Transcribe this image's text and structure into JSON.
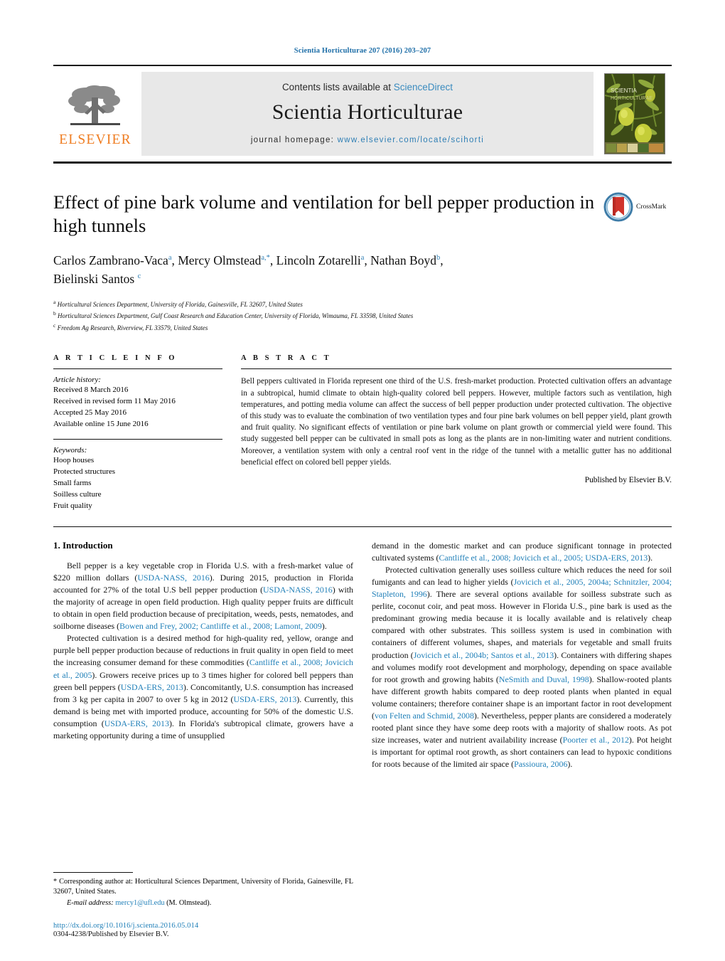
{
  "running_head": "Scientia Horticulturae 207 (2016) 203–207",
  "masthead": {
    "publisher_name": "ELSEVIER",
    "contents_prefix": "Contents lists available at ",
    "contents_link": "ScienceDirect",
    "journal_name": "Scientia Horticulturae",
    "homepage_prefix": "journal homepage: ",
    "homepage_url": "www.elsevier.com/locate/scihorti",
    "cover_title_line1": "SCIENTIA",
    "cover_title_line2": "HORTICULTURAE"
  },
  "article": {
    "title": "Effect of pine bark volume and ventilation for bell pepper production in high tunnels",
    "authors_line1": "Carlos Zambrano-Vaca",
    "authors_sup1": "a",
    "authors_line1b": ", Mercy Olmstead",
    "authors_sup2": "a,*",
    "authors_line1c": ", Lincoln Zotarelli",
    "authors_sup3": "a",
    "authors_line1d": ", Nathan Boyd",
    "authors_sup4": "b",
    "authors_line2": "Bielinski Santos",
    "authors_sup5": "c",
    "affiliations": [
      {
        "marker": "a",
        "text": "Horticultural Sciences Department, University of Florida, Gainesville, FL 32607, United States"
      },
      {
        "marker": "b",
        "text": "Horticultural Sciences Department, Gulf Coast Research and Education Center, University of Florida, Wimauma, FL 33598, United States"
      },
      {
        "marker": "c",
        "text": "Freedom Ag Research, Riverview, FL 33579, United States"
      }
    ],
    "crossmark_label": "CrossMark"
  },
  "article_info": {
    "heading": "A R T I C L E   I N F O",
    "history_label": "Article history:",
    "history": [
      "Received 8 March 2016",
      "Received in revised form 11 May 2016",
      "Accepted 25 May 2016",
      "Available online 15 June 2016"
    ],
    "keywords_label": "Keywords:",
    "keywords": [
      "Hoop houses",
      "Protected structures",
      "Small farms",
      "Soilless culture",
      "Fruit quality"
    ]
  },
  "abstract": {
    "heading": "A B S T R A C T",
    "text": "Bell peppers cultivated in Florida represent one third of the U.S. fresh-market production. Protected cultivation offers an advantage in a subtropical, humid climate to obtain high-quality colored bell peppers. However, multiple factors such as ventilation, high temperatures, and potting media volume can affect the success of bell pepper production under protected cultivation. The objective of this study was to evaluate the combination of two ventilation types and four pine bark volumes on bell pepper yield, plant growth and fruit quality. No significant effects of ventilation or pine bark volume on plant growth or commercial yield were found. This study suggested bell pepper can be cultivated in small pots as long as the plants are in non-limiting water and nutrient conditions. Moreover, a ventilation system with only a central roof vent in the ridge of the tunnel with a metallic gutter has no additional beneficial effect on colored bell pepper yields.",
    "published_by": "Published by Elsevier B.V."
  },
  "body": {
    "section_title": "1. Introduction",
    "left_p1_a": "Bell pepper is a key vegetable crop in Florida U.S. with a fresh-market value of $220 million dollars (",
    "left_p1_ref1": "USDA-NASS, 2016",
    "left_p1_b": "). During 2015, production in Florida accounted for 27% of the total U.S bell pepper production (",
    "left_p1_ref2": "USDA-NASS, 2016",
    "left_p1_c": ") with the majority of acreage in open field production. High quality pepper fruits are difficult to obtain in open field production because of precipitation, weeds, pests, nematodes, and soilborne diseases (",
    "left_p1_ref3": "Bowen and Frey, 2002; Cantliffe et al., 2008; Lamont, 2009",
    "left_p1_d": ").",
    "left_p2_a": "Protected cultivation is a desired method for high-quality red, yellow, orange and purple bell pepper production because of reductions in fruit quality in open field to meet the increasing consumer demand for these commodities (",
    "left_p2_ref1": "Cantliffe et al., 2008; Jovicich et al., 2005",
    "left_p2_b": "). Growers receive prices up to 3 times higher for colored bell peppers than green bell peppers (",
    "left_p2_ref2": "USDA-ERS, 2013",
    "left_p2_c": "). Concomitantly, U.S. consumption has increased from 3 kg per capita in 2007 to over 5 kg in 2012 (",
    "left_p2_ref3": "USDA-ERS, 2013",
    "left_p2_d": "). Currently, this demand is being met with imported produce, accounting for 50% of the domestic U.S. consumption (",
    "left_p2_ref4": "USDA-ERS, 2013",
    "left_p2_e": "). In Florida's subtropical climate, growers have a marketing opportunity during a time of unsupplied",
    "right_p1_a": "demand in the domestic market and can produce significant tonnage in protected cultivated systems (",
    "right_p1_ref1": "Cantliffe et al., 2008; Jovicich et al., 2005; USDA-ERS, 2013",
    "right_p1_b": ").",
    "right_p2_a": "Protected cultivation generally uses soilless culture which reduces the need for soil fumigants and can lead to higher yields (",
    "right_p2_ref1": "Jovicich et al., 2005, 2004a; Schnitzler, 2004; Stapleton, 1996",
    "right_p2_b": "). There are several options available for soilless substrate such as perlite, coconut coir, and peat moss. However in Florida U.S., pine bark is used as the predominant growing media because it is locally available and is relatively cheap compared with other substrates. This soilless system is used in combination with containers of different volumes, shapes, and materials for vegetable and small fruits production (",
    "right_p2_ref2": "Jovicich et al., 2004b; Santos et al., 2013",
    "right_p2_c": "). Containers with differing shapes and volumes modify root development and morphology, depending on space available for root growth and growing habits (",
    "right_p2_ref3": "NeSmith and Duval, 1998",
    "right_p2_d": "). Shallow-rooted plants have different growth habits compared to deep rooted plants when planted in equal volume containers; therefore container shape is an important factor in root development (",
    "right_p2_ref4": "von Felten and Schmid, 2008",
    "right_p2_e": "). Nevertheless, pepper plants are considered a moderately rooted plant since they have some deep roots with a majority of shallow roots. As pot size increases, water and nutrient availability increase (",
    "right_p2_ref5": "Poorter et al., 2012",
    "right_p2_f": "). Pot height is important for optimal root growth, as short containers can lead to hypoxic conditions for roots because of the limited air space (",
    "right_p2_ref6": "Passioura, 2006",
    "right_p2_g": ")."
  },
  "footnote": {
    "corresponding": "* Corresponding author at: Horticultural Sciences Department, University of Florida, Gainesville, FL 32607, United States.",
    "email_label": "E-mail address:",
    "email": "mercy1@ufl.edu",
    "email_suffix": " (M. Olmstead).",
    "doi": "http://dx.doi.org/10.1016/j.scienta.2016.05.014",
    "issn": "0304-4238/Published by Elsevier B.V."
  },
  "colors": {
    "link": "#1f7fb8",
    "elsevier_orange": "#ef7d22",
    "masthead_bg": "#e8e8e8"
  }
}
